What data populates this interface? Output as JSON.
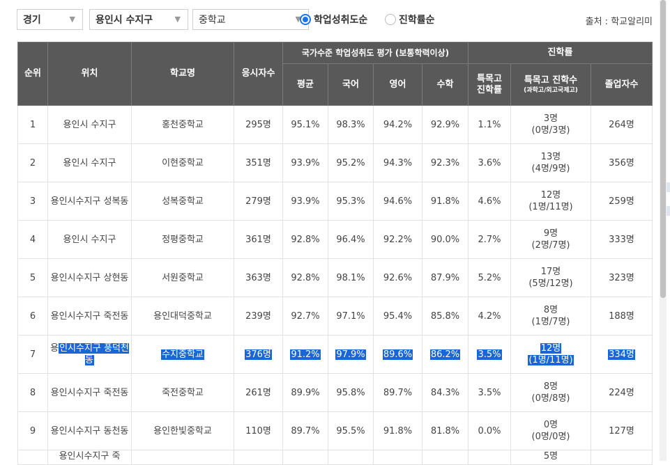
{
  "filters": {
    "region": "경기",
    "district": "용인시 수지구",
    "school_type": "중학교",
    "arrow_icon": "triangle-down"
  },
  "sort": {
    "option1": "학업성취도순",
    "option2": "진학률순",
    "selected": "option1"
  },
  "source_text": "출처 : 학교알리미",
  "table": {
    "headers": {
      "rank": "순위",
      "location": "위치",
      "school": "학교명",
      "applicants": "응시자수",
      "national_group": "국가수준 학업성취도 평가 (보통학력이상)",
      "avg": "평균",
      "korean": "국어",
      "english": "영어",
      "math": "수학",
      "advancement_group": "진학률",
      "special_rate": "특목고 진학률",
      "special_count": "특목고 진학수",
      "special_count_sub": "(과학고/외고국제고)",
      "graduates": "졸업자수"
    },
    "rows": [
      {
        "rank": "1",
        "location": "용인시 수지구",
        "school": "홍천중학교",
        "applicants": "295명",
        "avg": "95.1%",
        "korean": "98.3%",
        "english": "94.2%",
        "math": "92.9%",
        "special_rate": "1.1%",
        "special_count": "3명",
        "special_detail": "(0명/3명)",
        "graduates": "264명"
      },
      {
        "rank": "2",
        "location": "용인시 수지구",
        "school": "이현중학교",
        "applicants": "351명",
        "avg": "93.9%",
        "korean": "95.2%",
        "english": "94.3%",
        "math": "92.3%",
        "special_rate": "3.6%",
        "special_count": "13명",
        "special_detail": "(4명/9명)",
        "graduates": "356명"
      },
      {
        "rank": "3",
        "location": "용인시수지구 성복동",
        "school": "성복중학교",
        "applicants": "279명",
        "avg": "93.9%",
        "korean": "95.3%",
        "english": "94.6%",
        "math": "91.8%",
        "special_rate": "4.6%",
        "special_count": "12명",
        "special_detail": "(1명/11명)",
        "graduates": "259명"
      },
      {
        "rank": "4",
        "location": "용인시 수지구",
        "school": "정평중학교",
        "applicants": "361명",
        "avg": "92.8%",
        "korean": "96.4%",
        "english": "92.2%",
        "math": "90.0%",
        "special_rate": "2.7%",
        "special_count": "9명",
        "special_detail": "(2명/7명)",
        "graduates": "333명"
      },
      {
        "rank": "5",
        "location": "용인시수지구 상현동",
        "school": "서원중학교",
        "applicants": "363명",
        "avg": "92.8%",
        "korean": "98.1%",
        "english": "92.6%",
        "math": "87.9%",
        "special_rate": "5.2%",
        "special_count": "17명",
        "special_detail": "(5명/12명)",
        "graduates": "323명"
      },
      {
        "rank": "6",
        "location": "용인시수지구 죽전동",
        "school": "용인대덕중학교",
        "applicants": "239명",
        "avg": "92.7%",
        "korean": "97.1%",
        "english": "95.4%",
        "math": "85.8%",
        "special_rate": "4.2%",
        "special_count": "8명",
        "special_detail": "(1명/7명)",
        "graduates": "188명"
      },
      {
        "rank": "7",
        "location_pre": "용",
        "location": "인시수지구 풍덕천동",
        "school": "수지중학교",
        "applicants": "376명",
        "avg": "91.2%",
        "korean": "97.9%",
        "english": "89.6%",
        "math": "86.2%",
        "special_rate": "3.5%",
        "special_count": "12명",
        "special_detail": "(1명/11명)",
        "graduates": "334명",
        "highlighted": true
      },
      {
        "rank": "8",
        "location": "용인시수지구 죽전동",
        "school": "죽전중학교",
        "applicants": "261명",
        "avg": "89.9%",
        "korean": "95.8%",
        "english": "89.7%",
        "math": "84.3%",
        "special_rate": "3.5%",
        "special_count": "8명",
        "special_detail": "(0명/8명)",
        "graduates": "224명"
      },
      {
        "rank": "9",
        "location": "용인시수지구 동천동",
        "school": "용인한빛중학교",
        "applicants": "110명",
        "avg": "89.7%",
        "korean": "95.5%",
        "english": "91.8%",
        "math": "81.8%",
        "special_rate": "0.0%",
        "special_count": "0명",
        "special_detail": "(0명/0명)",
        "graduates": "127명"
      },
      {
        "rank": "",
        "location": "용인시수지구 죽",
        "school": "",
        "applicants": "",
        "avg": "",
        "korean": "",
        "english": "",
        "math": "",
        "special_rate": "",
        "special_count": "5명",
        "special_detail": "",
        "graduates": "",
        "partial": true
      }
    ]
  },
  "colors": {
    "header_bg": "#595959",
    "selection": "#1a66d6",
    "radio_accent": "#1a73e8"
  }
}
